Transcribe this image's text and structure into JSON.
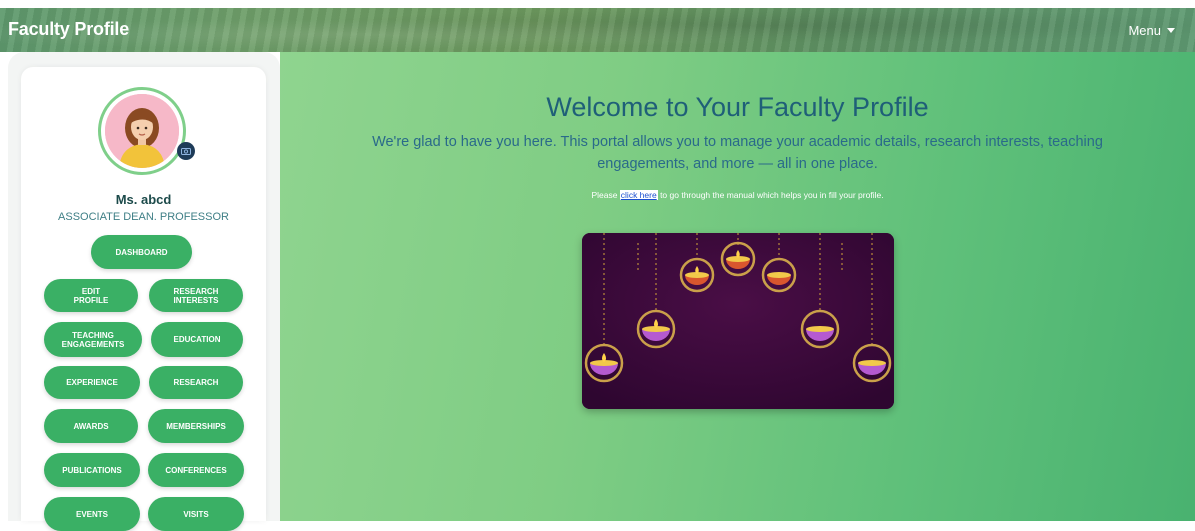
{
  "navbar": {
    "brand": "Faculty Profile",
    "menu_label": "Menu"
  },
  "profile": {
    "name": "Ms. abcd",
    "role": "ASSOCIATE DEAN. PROFESSOR"
  },
  "sidebar": {
    "buttons": [
      "DASHBOARD",
      "EDIT PROFILE",
      "RESEARCH INTERESTS",
      "TEACHING ENGAGEMENTS",
      "EDUCATION",
      "EXPERIENCE",
      "RESEARCH",
      "AWARDS",
      "MEMBERSHIPS",
      "PUBLICATIONS",
      "CONFERENCES",
      "EVENTS",
      "VISITS"
    ]
  },
  "main": {
    "title": "Welcome to Your Faculty Profile",
    "lead": "We're glad to have you here. This portal allows you to manage your academic details, research interests, teaching engagements, and more — all in one place.",
    "manual_prefix": "Please ",
    "manual_link": "click here",
    "manual_suffix": " to go through the manual which helps you in fill your profile."
  },
  "colors": {
    "accent_green": "#3ab065",
    "title_blue": "#1f5f78",
    "banner_bg": "#3e0a3a"
  }
}
